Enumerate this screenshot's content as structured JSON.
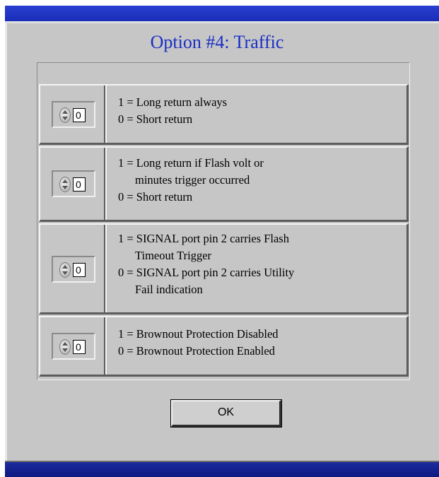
{
  "window": {
    "title": "Option #4: Traffic"
  },
  "options": [
    {
      "value": "0",
      "lines": [
        "1  =  Long return always",
        "0  =  Short return"
      ]
    },
    {
      "value": "0",
      "lines": [
        "1  =  Long return if Flash volt or",
        "minutes trigger occurred",
        "0  =  Short return"
      ]
    },
    {
      "value": "0",
      "lines": [
        "1  =  SIGNAL port pin 2 carries Flash",
        "Timeout Trigger",
        "0  =  SIGNAL port pin 2 carries Utility",
        "Fail indication"
      ]
    },
    {
      "value": "0",
      "lines": [
        "1  =  Brownout Protection Disabled",
        "0  =  Brownout Protection Enabled"
      ]
    }
  ],
  "buttons": {
    "ok_label": "OK"
  },
  "icons": {
    "spinner": "up-down-spinner-icon"
  },
  "colors": {
    "title": "#1a2fc4",
    "panel": "#c6c6c6",
    "bar": "#1a2db8"
  }
}
